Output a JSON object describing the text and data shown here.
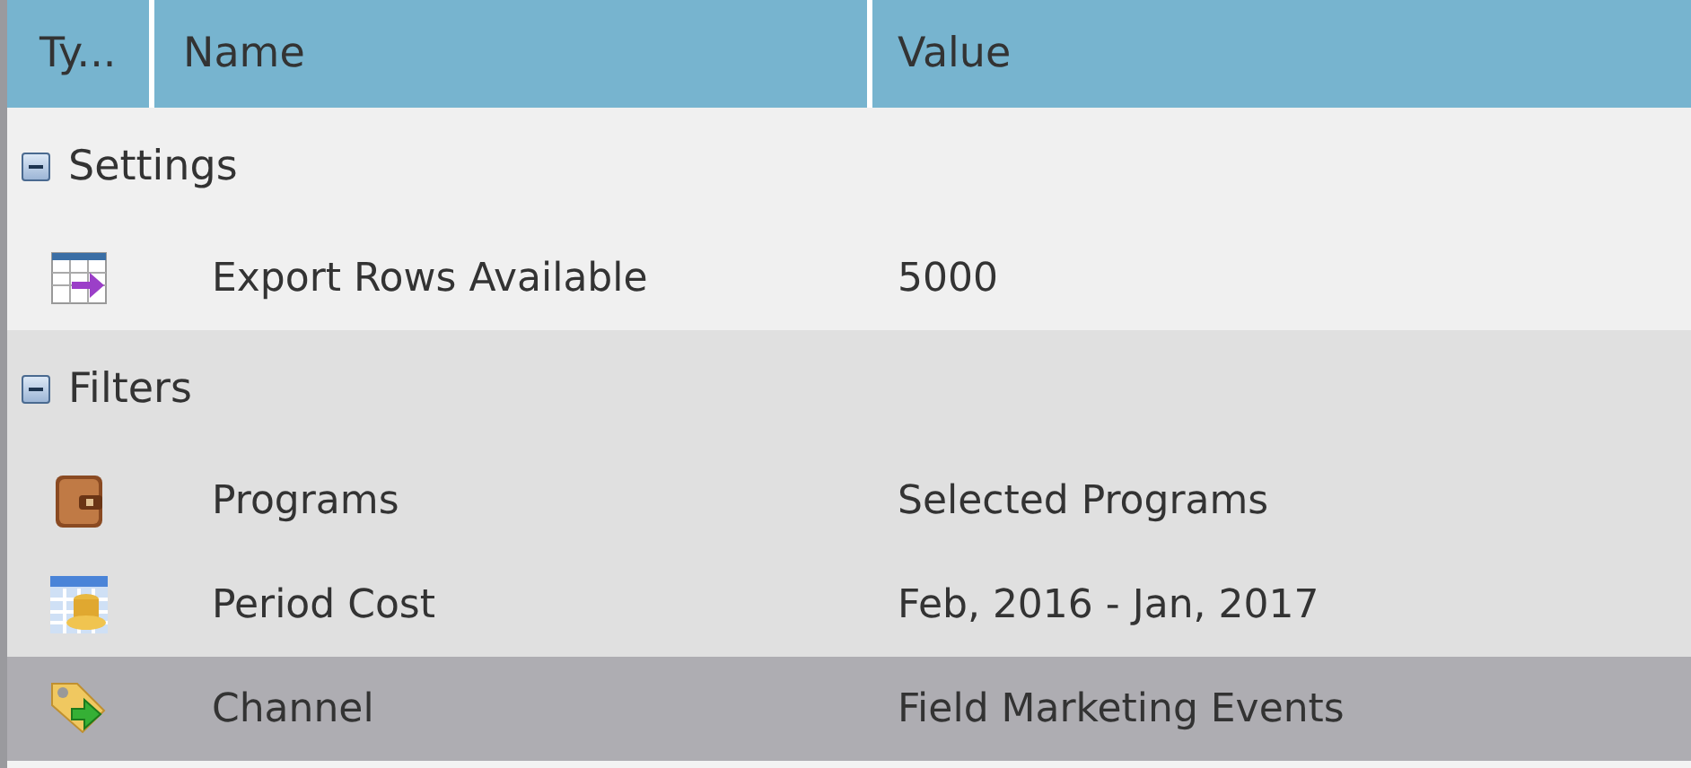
{
  "table": {
    "columns": [
      "Ty...",
      "Name",
      "Value"
    ],
    "groups": [
      {
        "label": "Settings",
        "expanded": true,
        "items": [
          {
            "kind": "export",
            "name": "Export Rows Available",
            "value": "5000",
            "selected": false
          }
        ]
      },
      {
        "label": "Filters",
        "expanded": true,
        "items": [
          {
            "kind": "program",
            "name": "Programs",
            "value": "Selected Programs",
            "selected": false
          },
          {
            "kind": "cost",
            "name": "Period Cost",
            "value": "Feb, 2016 - Jan, 2017",
            "selected": false
          },
          {
            "kind": "channel",
            "name": "Channel",
            "value": "Field Marketing Events",
            "selected": true
          }
        ]
      }
    ]
  }
}
